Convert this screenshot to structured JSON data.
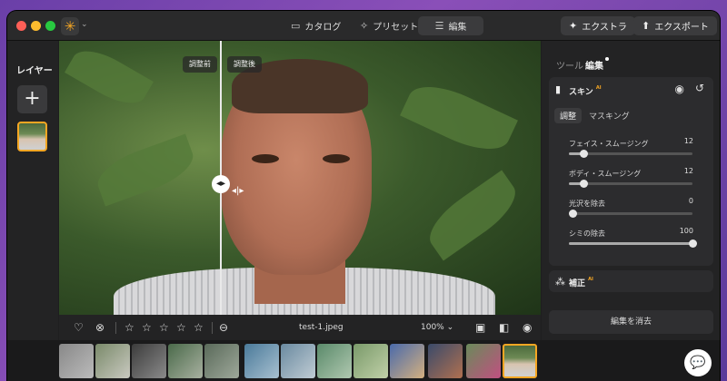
{
  "titlebar": {
    "tabs": [
      {
        "label": "カタログ",
        "icon": "folder-icon"
      },
      {
        "label": "プリセット",
        "icon": "sparkle-icon"
      },
      {
        "label": "編集",
        "icon": "sliders-icon"
      }
    ],
    "extra_label": "エクストラ",
    "export_label": "エクスポート"
  },
  "layers": {
    "title": "レイヤー"
  },
  "photo": {
    "before_label": "調整前",
    "after_label": "調整後"
  },
  "photo_toolbar": {
    "filename": "test-1.jpeg",
    "zoom": "100%",
    "rating_stars": 5
  },
  "right_panel": {
    "tabs": [
      "ツール",
      "編集"
    ],
    "skin_card": {
      "title": "スキン",
      "badge": "AI",
      "subtabs": [
        "調整",
        "マスキング"
      ],
      "sliders": [
        {
          "label": "フェイス・スムージング",
          "value": "12",
          "fraction": 0.12
        },
        {
          "label": "ボディ・スムージング",
          "value": "12",
          "fraction": 0.12
        },
        {
          "label": "光沢を除去",
          "value": "0",
          "fraction": 0.0
        },
        {
          "label": "シミの除去",
          "value": "100",
          "fraction": 1.0
        }
      ]
    },
    "correction_card": {
      "title": "補正",
      "badge": "AI"
    },
    "clear_label": "編集を消去"
  },
  "colors": {
    "accent": "#f5a623",
    "panel": "#232324",
    "window": "#1e1e1f"
  }
}
